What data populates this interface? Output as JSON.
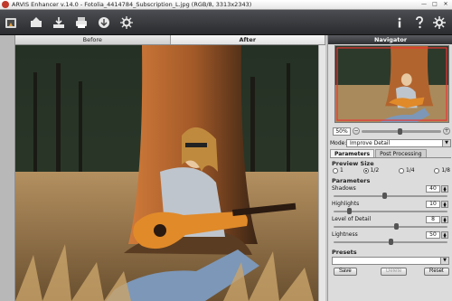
{
  "window": {
    "title": "ARVIS Enhancer v.14.0 - Fotolia_4414784_Subscription_L.jpg (RGB/8, 3313x2343)"
  },
  "toolbar": {
    "left_icons": [
      "open-icon",
      "save-icon",
      "download-icon",
      "print-icon",
      "share-icon",
      "settings-icon"
    ],
    "right_icons": [
      "info-icon",
      "help-icon",
      "preferences-icon"
    ]
  },
  "view_tabs": [
    {
      "label": "Before",
      "active": false
    },
    {
      "label": "After",
      "active": true
    }
  ],
  "navigator": {
    "title": "Navigator",
    "zoom": "50%",
    "zoom_level": 0.45
  },
  "mode": {
    "label": "Mode:",
    "value": "Improve Detail"
  },
  "panel_tabs": [
    {
      "label": "Parameters",
      "active": true
    },
    {
      "label": "Post Processing",
      "active": false
    }
  ],
  "preview_size": {
    "title": "Preview Size",
    "options": [
      "1",
      "1/2",
      "1/4",
      "1/8"
    ],
    "selected": "1/2"
  },
  "parameters": {
    "title": "Parameters",
    "items": [
      {
        "label": "Shadows",
        "value": "40",
        "level": 0.45
      },
      {
        "label": "Highlights",
        "value": "10",
        "level": 0.12
      },
      {
        "label": "Level of Detail",
        "value": "8",
        "level": 0.55
      },
      {
        "label": "Lightness",
        "value": "50",
        "level": 0.5
      }
    ]
  },
  "presets": {
    "title": "Presets",
    "selected": "",
    "save_label": "Save",
    "delete_label": "Delete",
    "reset_label": "Reset"
  },
  "colors": {
    "toolbar_bg": "#2f3034",
    "panel_header": "#3c3d41",
    "panel_bg": "#dcdcdc"
  }
}
